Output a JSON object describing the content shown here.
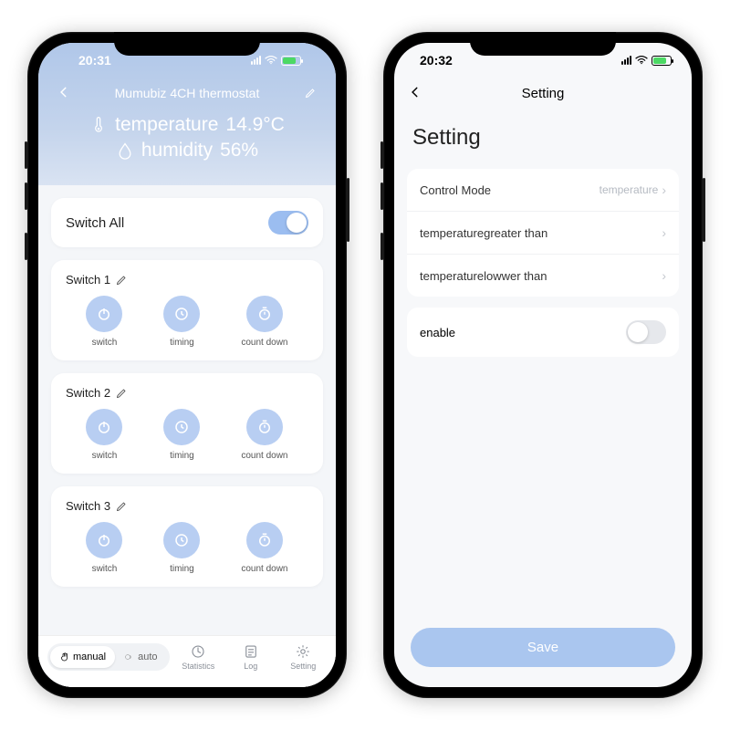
{
  "left": {
    "status": {
      "time": "20:31"
    },
    "header": {
      "title": "Mumubiz 4CH thermostat",
      "temperature_label": "temperature",
      "temperature_value": "14.9°C",
      "humidity_label": "humidity",
      "humidity_value": "56%"
    },
    "switch_all_label": "Switch All",
    "switches": [
      {
        "title": "Switch 1",
        "btns": [
          "switch",
          "timing",
          "count down"
        ]
      },
      {
        "title": "Switch 2",
        "btns": [
          "switch",
          "timing",
          "count down"
        ]
      },
      {
        "title": "Switch 3",
        "btns": [
          "switch",
          "timing",
          "count down"
        ]
      }
    ],
    "bottom": {
      "mode_manual": "manual",
      "mode_auto": "auto",
      "nav": [
        "Statistics",
        "Log",
        "Setting"
      ]
    }
  },
  "right": {
    "status": {
      "time": "20:32"
    },
    "title_small": "Setting",
    "title_big": "Setting",
    "rows": [
      {
        "label": "Control Mode",
        "value": "temperature"
      },
      {
        "label": "temperaturegreater than",
        "value": ""
      },
      {
        "label": "temperaturelowwer than",
        "value": ""
      }
    ],
    "enable_label": "enable",
    "save_label": "Save"
  }
}
